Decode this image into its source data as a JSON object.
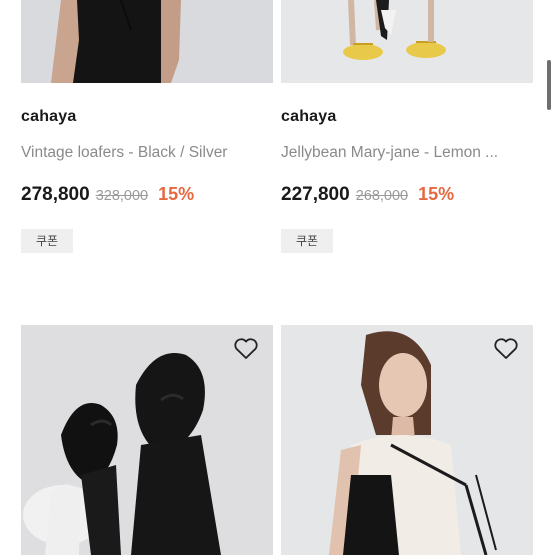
{
  "products": [
    {
      "brand": "cahaya",
      "name": "Vintage loafers - Black / Silver",
      "price": "278,800",
      "original_price": "328,000",
      "discount": "15%",
      "coupon_label": "쿠폰"
    },
    {
      "brand": "cahaya",
      "name": "Jellybean Mary-jane - Lemon ...",
      "price": "227,800",
      "original_price": "268,000",
      "discount": "15%",
      "coupon_label": "쿠폰"
    },
    {
      "wishlist_icon": "heart-outline-icon"
    },
    {
      "wishlist_icon": "heart-outline-icon"
    }
  ],
  "colors": {
    "discount": "#e5683f",
    "strikethrough_price": "#9a9a9a",
    "product_name": "#8a8a8a",
    "coupon_bg": "#efefef"
  }
}
